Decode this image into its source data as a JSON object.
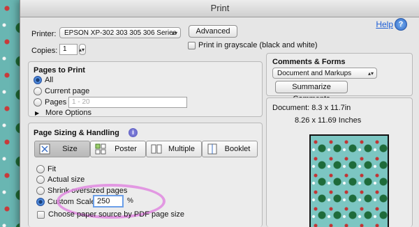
{
  "window": {
    "title": "Print",
    "help_label": "Help",
    "help_icon": "question-mark"
  },
  "printer": {
    "label": "Printer:",
    "value": "EPSON XP-302 303 305 306 Series",
    "advanced_label": "Advanced"
  },
  "copies": {
    "label": "Copies:",
    "value": "1"
  },
  "grayscale": {
    "label": "Print in grayscale (black and white)",
    "checked": false
  },
  "pages_to_print": {
    "title": "Pages to Print",
    "all_label": "All",
    "current_label": "Current page",
    "pages_label": "Pages",
    "pages_placeholder": "1 - 20",
    "more_options_label": "More Options",
    "selected": "All"
  },
  "page_sizing": {
    "title": "Page Sizing & Handling",
    "tabs": [
      "Size",
      "Poster",
      "Multiple",
      "Booklet"
    ],
    "selected_tab": "Size",
    "options": {
      "fit": "Fit",
      "actual": "Actual size",
      "shrink": "Shrink oversized pages",
      "custom": "Custom Scale:"
    },
    "selected_option": "Custom Scale:",
    "custom_scale_value": "250",
    "percent_label": "%",
    "paper_source_label": "Choose paper source by PDF page size"
  },
  "comments_forms": {
    "title": "Comments & Forms",
    "value": "Document and Markups",
    "summarize_label": "Summarize Comments"
  },
  "document": {
    "size_text": "Document: 8.3 x 11.7in",
    "inches_text": "8.26 x 11.69 Inches"
  }
}
